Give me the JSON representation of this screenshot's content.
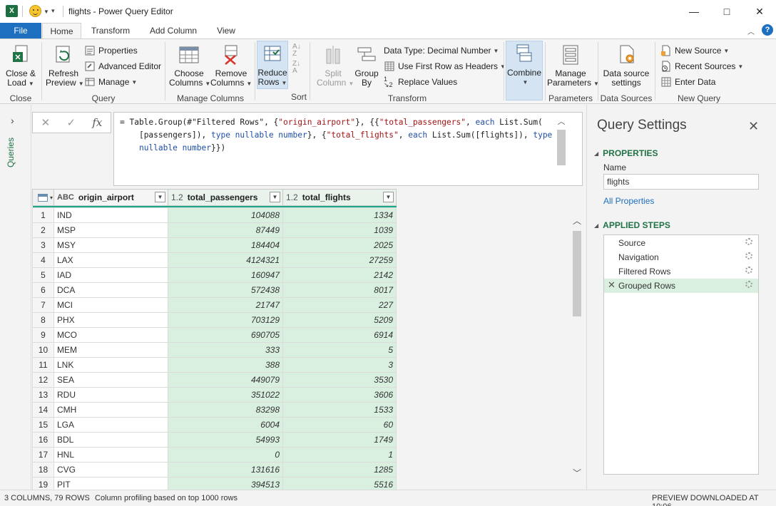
{
  "window": {
    "title": "flights - Power Query Editor",
    "minimize_icon": "—",
    "maximize_icon": "□",
    "close_icon": "✕"
  },
  "tabs": [
    {
      "label": "File"
    },
    {
      "label": "Home"
    },
    {
      "label": "Transform"
    },
    {
      "label": "Add Column"
    },
    {
      "label": "View"
    }
  ],
  "ribbon": {
    "close": {
      "btn_line1": "Close &",
      "btn_line2": "Load",
      "group": "Close"
    },
    "query": {
      "refresh_line1": "Refresh",
      "refresh_line2": "Preview",
      "properties": "Properties",
      "advanced_editor": "Advanced Editor",
      "manage": "Manage",
      "group": "Query"
    },
    "manage_columns": {
      "choose_line1": "Choose",
      "choose_line2": "Columns",
      "remove_line1": "Remove",
      "remove_line2": "Columns",
      "group": "Manage Columns"
    },
    "reduce": {
      "line1": "Reduce",
      "line2": "Rows"
    },
    "sort": {
      "group": "Sort"
    },
    "transform": {
      "split_line1": "Split",
      "split_line2": "Column",
      "group_line1": "Group",
      "group_line2": "By",
      "data_type": "Data Type: Decimal Number",
      "first_row": "Use First Row as Headers",
      "replace": "Replace Values",
      "group": "Transform"
    },
    "combine": {
      "label": "Combine"
    },
    "parameters": {
      "line1": "Manage",
      "line2": "Parameters",
      "group": "Parameters"
    },
    "data_sources": {
      "line1": "Data source",
      "line2": "settings",
      "group": "Data Sources"
    },
    "new_query": {
      "new_source": "New Source",
      "recent_sources": "Recent Sources",
      "enter_data": "Enter Data",
      "group": "New Query"
    }
  },
  "queries_rail": {
    "label": "Queries"
  },
  "formula": {
    "cancel_icon": "✕",
    "commit_icon": "✓",
    "fx": "fx"
  },
  "grid": {
    "columns": [
      {
        "type": "ABC",
        "name": "origin_airport"
      },
      {
        "type": "1.2",
        "name": "total_passengers"
      },
      {
        "type": "1.2",
        "name": "total_flights"
      }
    ],
    "rows": [
      [
        "1",
        "IND",
        "104088",
        "1334"
      ],
      [
        "2",
        "MSP",
        "87449",
        "1039"
      ],
      [
        "3",
        "MSY",
        "184404",
        "2025"
      ],
      [
        "4",
        "LAX",
        "4124321",
        "27259"
      ],
      [
        "5",
        "IAD",
        "160947",
        "2142"
      ],
      [
        "6",
        "DCA",
        "572438",
        "8017"
      ],
      [
        "7",
        "MCI",
        "21747",
        "227"
      ],
      [
        "8",
        "PHX",
        "703129",
        "5209"
      ],
      [
        "9",
        "MCO",
        "690705",
        "6914"
      ],
      [
        "10",
        "MEM",
        "333",
        "5"
      ],
      [
        "11",
        "LNK",
        "388",
        "3"
      ],
      [
        "12",
        "SEA",
        "449079",
        "3530"
      ],
      [
        "13",
        "RDU",
        "351022",
        "3606"
      ],
      [
        "14",
        "CMH",
        "83298",
        "1533"
      ],
      [
        "15",
        "LGA",
        "6004",
        "60"
      ],
      [
        "16",
        "BDL",
        "54993",
        "1749"
      ],
      [
        "17",
        "HNL",
        "0",
        "1"
      ],
      [
        "18",
        "CVG",
        "131616",
        "1285"
      ],
      [
        "19",
        "PIT",
        "394513",
        "5516"
      ]
    ]
  },
  "query_settings": {
    "title": "Query Settings",
    "properties_header": "PROPERTIES",
    "name_label": "Name",
    "name_value": "flights",
    "all_properties": "All Properties",
    "applied_steps_header": "APPLIED STEPS",
    "steps": [
      {
        "label": "Source"
      },
      {
        "label": "Navigation"
      },
      {
        "label": "Filtered Rows"
      },
      {
        "label": "Grouped Rows"
      }
    ]
  },
  "status": {
    "left": "3 COLUMNS, 79 ROWS",
    "profiling": "Column profiling based on top 1000 rows",
    "right": "PREVIEW DOWNLOADED AT 10:06"
  },
  "colors": {
    "accent": "#217346",
    "file_tab": "#1e6fc0",
    "numeric_column": "#d9efe0"
  }
}
